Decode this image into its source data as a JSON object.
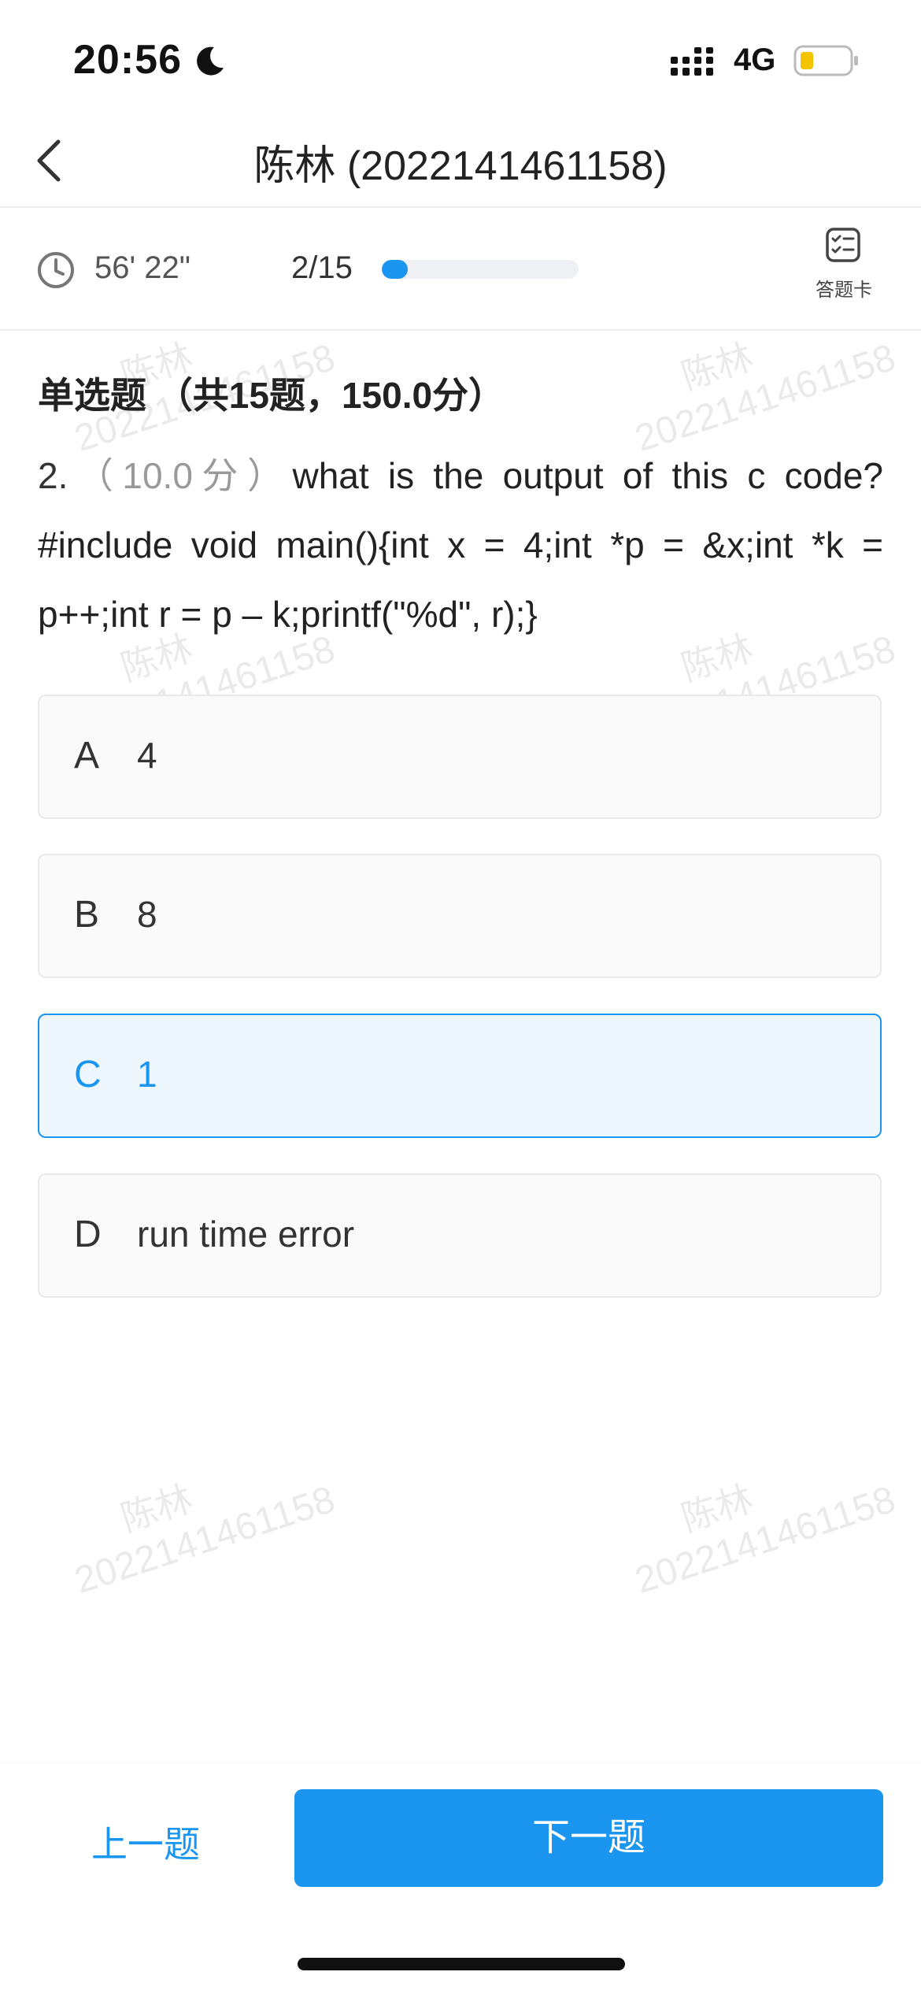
{
  "status_bar": {
    "time": "20:56",
    "network": "4G",
    "battery_color": "#f5c400"
  },
  "nav": {
    "title": "陈林 (2022141461158)"
  },
  "timer": {
    "elapsed": "56' 22\""
  },
  "progress": {
    "label": "2/15",
    "fraction": 0.1333
  },
  "answer_card": {
    "label": "答题卡"
  },
  "watermark": {
    "name": "陈林",
    "id": "2022141461158"
  },
  "section": {
    "title": "单选题 （共15题，150.0分）"
  },
  "question": {
    "number": "2.",
    "score": "（10.0分）",
    "text": "what is the output of this c code? #include void main(){int x = 4;int *p = &x;int *k = p++;int r = p – k;printf(\"%d\", r);}"
  },
  "options": [
    {
      "letter": "A",
      "text": "4",
      "selected": false
    },
    {
      "letter": "B",
      "text": "8",
      "selected": false
    },
    {
      "letter": "C",
      "text": "1",
      "selected": true
    },
    {
      "letter": "D",
      "text": "run time error",
      "selected": false
    }
  ],
  "buttons": {
    "prev": "上一题",
    "next": "下一题"
  },
  "colors": {
    "accent": "#1a95f0",
    "selected_bg": "#eef7fe"
  }
}
